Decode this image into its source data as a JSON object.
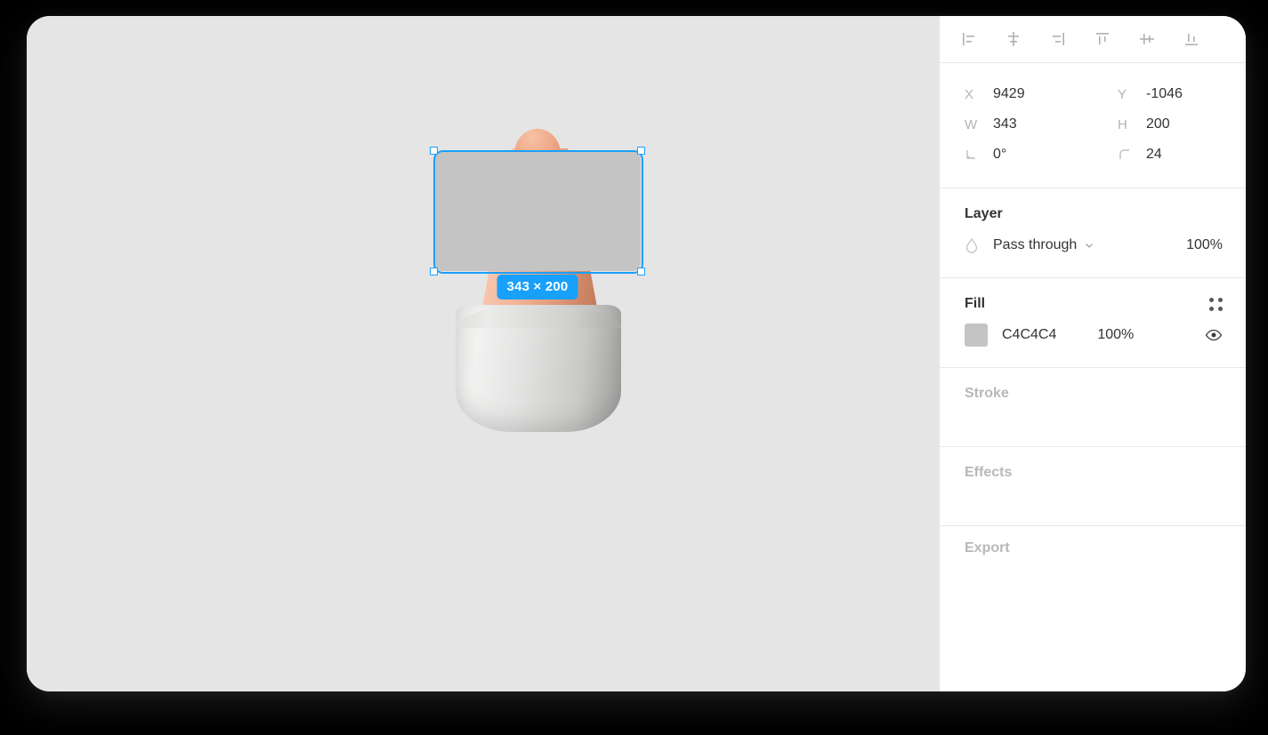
{
  "canvas": {
    "background_color": "#E5E5E5",
    "selection": {
      "size_badge": "343 × 200",
      "accent_color": "#18A0FB",
      "rect_fill": "#C4C4C4"
    }
  },
  "panel": {
    "align_toolbar": [
      {
        "name": "align-left",
        "label": "Align left"
      },
      {
        "name": "align-horizontal-center",
        "label": "Align horizontal centers"
      },
      {
        "name": "align-right",
        "label": "Align right"
      },
      {
        "name": "align-top",
        "label": "Align top"
      },
      {
        "name": "align-vertical-center",
        "label": "Align vertical centers"
      },
      {
        "name": "align-bottom",
        "label": "Align bottom"
      }
    ],
    "properties": {
      "x_label": "X",
      "x_value": "9429",
      "y_label": "Y",
      "y_value": "-1046",
      "w_label": "W",
      "w_value": "343",
      "h_label": "H",
      "h_value": "200",
      "rotation_value": "0°",
      "corner_radius_value": "24"
    },
    "layer": {
      "title": "Layer",
      "blend_mode": "Pass through",
      "opacity": "100%"
    },
    "fill": {
      "title": "Fill",
      "color_hex": "C4C4C4",
      "swatch_color": "#C4C4C4",
      "opacity": "100%"
    },
    "stroke": {
      "title": "Stroke"
    },
    "effects": {
      "title": "Effects"
    },
    "export": {
      "title": "Export"
    }
  }
}
